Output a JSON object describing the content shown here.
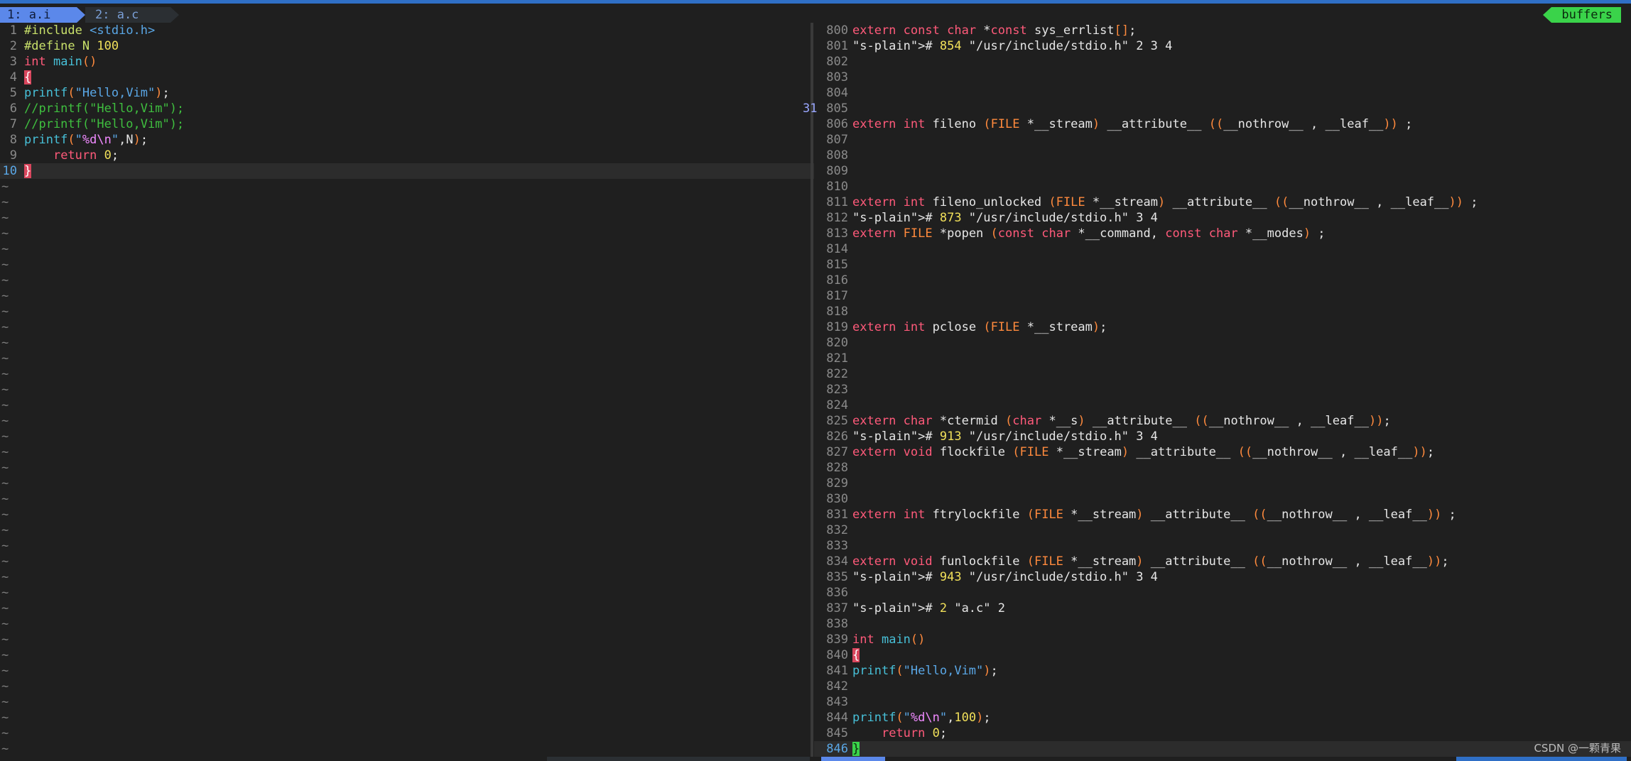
{
  "tabline": {
    "active_tab": "1: a.i",
    "inactive_tab": "2: a.c",
    "buffers_label": "buffers"
  },
  "left_pane": {
    "lines": [
      {
        "num": "1",
        "text": "#include <stdio.h>"
      },
      {
        "num": "2",
        "text": "#define N 100"
      },
      {
        "num": "3",
        "text": "int main()"
      },
      {
        "num": "4",
        "text": "{"
      },
      {
        "num": "5",
        "text": "printf(\"Hello,Vim\");"
      },
      {
        "num": "6",
        "text": "//printf(\"Hello,Vim\");"
      },
      {
        "num": "7",
        "text": "//printf(\"Hello,Vim\");"
      },
      {
        "num": "8",
        "text": "printf(\"%d\\n\",N);"
      },
      {
        "num": "9",
        "text": "    return 0;"
      },
      {
        "num": "10",
        "text": "}"
      }
    ],
    "empty_line_marker": "~"
  },
  "right_pane": {
    "fold_marker": "31",
    "lines": [
      {
        "num": "800",
        "text": "extern const char *const sys_errlist[];"
      },
      {
        "num": "801",
        "text": "# 854 \"/usr/include/stdio.h\" 2 3 4"
      },
      {
        "num": "802",
        "text": ""
      },
      {
        "num": "803",
        "text": ""
      },
      {
        "num": "804",
        "text": ""
      },
      {
        "num": "805",
        "text": ""
      },
      {
        "num": "806",
        "text": "extern int fileno (FILE *__stream) __attribute__ ((__nothrow__ , __leaf__)) ;"
      },
      {
        "num": "807",
        "text": ""
      },
      {
        "num": "808",
        "text": ""
      },
      {
        "num": "809",
        "text": ""
      },
      {
        "num": "810",
        "text": ""
      },
      {
        "num": "811",
        "text": "extern int fileno_unlocked (FILE *__stream) __attribute__ ((__nothrow__ , __leaf__)) ;"
      },
      {
        "num": "812",
        "text": "# 873 \"/usr/include/stdio.h\" 3 4"
      },
      {
        "num": "813",
        "text": "extern FILE *popen (const char *__command, const char *__modes) ;"
      },
      {
        "num": "814",
        "text": ""
      },
      {
        "num": "815",
        "text": ""
      },
      {
        "num": "816",
        "text": ""
      },
      {
        "num": "817",
        "text": ""
      },
      {
        "num": "818",
        "text": ""
      },
      {
        "num": "819",
        "text": "extern int pclose (FILE *__stream);"
      },
      {
        "num": "820",
        "text": ""
      },
      {
        "num": "821",
        "text": ""
      },
      {
        "num": "822",
        "text": ""
      },
      {
        "num": "823",
        "text": ""
      },
      {
        "num": "824",
        "text": ""
      },
      {
        "num": "825",
        "text": "extern char *ctermid (char *__s) __attribute__ ((__nothrow__ , __leaf__));"
      },
      {
        "num": "826",
        "text": "# 913 \"/usr/include/stdio.h\" 3 4"
      },
      {
        "num": "827",
        "text": "extern void flockfile (FILE *__stream) __attribute__ ((__nothrow__ , __leaf__));"
      },
      {
        "num": "828",
        "text": ""
      },
      {
        "num": "829",
        "text": ""
      },
      {
        "num": "830",
        "text": ""
      },
      {
        "num": "831",
        "text": "extern int ftrylockfile (FILE *__stream) __attribute__ ((__nothrow__ , __leaf__)) ;"
      },
      {
        "num": "832",
        "text": ""
      },
      {
        "num": "833",
        "text": ""
      },
      {
        "num": "834",
        "text": "extern void funlockfile (FILE *__stream) __attribute__ ((__nothrow__ , __leaf__));"
      },
      {
        "num": "835",
        "text": "# 943 \"/usr/include/stdio.h\" 3 4"
      },
      {
        "num": "836",
        "text": ""
      },
      {
        "num": "837",
        "text": "# 2 \"a.c\" 2"
      },
      {
        "num": "838",
        "text": ""
      },
      {
        "num": "839",
        "text": "int main()"
      },
      {
        "num": "840",
        "text": "{"
      },
      {
        "num": "841",
        "text": "printf(\"Hello,Vim\");"
      },
      {
        "num": "842",
        "text": ""
      },
      {
        "num": "843",
        "text": ""
      },
      {
        "num": "844",
        "text": "printf(\"%d\\n\",100);"
      },
      {
        "num": "845",
        "text": "    return 0;"
      },
      {
        "num": "846",
        "text": "}"
      }
    ]
  },
  "watermark": "CSDN @一颗青果",
  "colors": {
    "background": "#1f1f1f",
    "active_tab": "#5b88ea",
    "buffers": "#3ad34a",
    "keyword": "#ff5a7a",
    "string": "#5aa7e6",
    "number": "#f1e05a",
    "comment": "#3fbf3f",
    "parens": "#ff8a3d"
  }
}
